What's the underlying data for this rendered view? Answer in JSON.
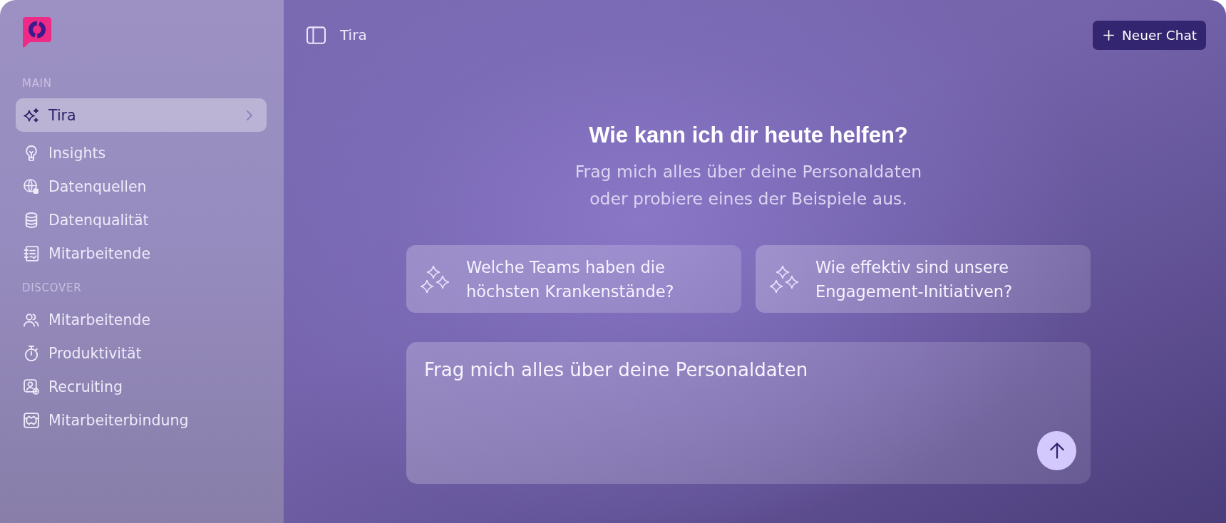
{
  "sidebar": {
    "sections": [
      {
        "label": "MAIN",
        "items": [
          {
            "label": "Tira",
            "selected": true
          },
          {
            "label": "Insights",
            "selected": false
          },
          {
            "label": "Datenquellen",
            "selected": false
          },
          {
            "label": "Datenqualität",
            "selected": false
          },
          {
            "label": "Mitarbeitende",
            "selected": false
          }
        ]
      },
      {
        "label": "DISCOVER",
        "items": [
          {
            "label": "Mitarbeitende",
            "selected": false
          },
          {
            "label": "Produktivität",
            "selected": false
          },
          {
            "label": "Recruiting",
            "selected": false
          },
          {
            "label": "Mitarbeiterbindung",
            "selected": false
          }
        ]
      }
    ]
  },
  "header": {
    "title": "Tira",
    "new_chat_button": "Neuer Chat"
  },
  "hero": {
    "title": "Wie kann ich dir heute helfen?",
    "subtitle": "Frag mich alles über deine Personaldaten oder probiere eines der Beispiele aus."
  },
  "suggestions": [
    {
      "text": "Welche Teams haben die höchsten Krankenstände?"
    },
    {
      "text": "Wie effektiv sind unsere Engagement-Initiativen?"
    }
  ],
  "chat_input": {
    "placeholder": "Frag mich alles über deine Personaldaten"
  }
}
